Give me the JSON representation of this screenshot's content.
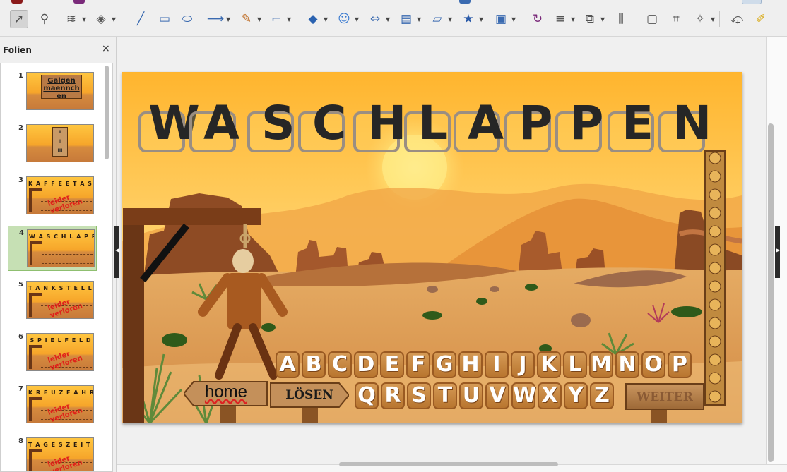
{
  "toolbar": {
    "tools": [
      {
        "icon": "select-cursor-icon"
      },
      {
        "icon": "zoom-pan-icon"
      },
      {
        "icon": "line-color-icon"
      },
      {
        "icon": "fill-color-icon"
      },
      {
        "icon": "line-icon"
      },
      {
        "icon": "rectangle-icon"
      },
      {
        "icon": "ellipse-icon"
      },
      {
        "icon": "line-ends-arrow-icon"
      },
      {
        "icon": "curves-polygons-icon"
      },
      {
        "icon": "connectors-icon"
      },
      {
        "icon": "basic-shapes-icon"
      },
      {
        "icon": "symbol-shapes-icon"
      },
      {
        "icon": "block-arrows-icon"
      },
      {
        "icon": "flowchart-icon"
      },
      {
        "icon": "callouts-icon"
      },
      {
        "icon": "stars-icon"
      },
      {
        "icon": "3d-objects-icon"
      },
      {
        "icon": "rotate-icon"
      },
      {
        "icon": "align-icon"
      },
      {
        "icon": "arrange-icon"
      },
      {
        "icon": "distribute-icon"
      },
      {
        "icon": "shadow-icon"
      },
      {
        "icon": "crop-icon"
      },
      {
        "icon": "filter-wand-icon"
      },
      {
        "icon": "points-icon"
      },
      {
        "icon": "glue-points-icon"
      }
    ]
  },
  "slide_panel": {
    "title": "Folien",
    "close_glyph": "×",
    "slides": [
      {
        "number": "1",
        "title": "Galgen maennch en",
        "note": "",
        "selected": false
      },
      {
        "number": "2",
        "title": "",
        "levels": [
          "I",
          "II",
          "III"
        ],
        "note": "",
        "selected": false
      },
      {
        "number": "3",
        "title": "KAFFEETASSE",
        "note": "leider verloren",
        "selected": false
      },
      {
        "number": "4",
        "title": "WASCHLAPPEN",
        "note": "",
        "selected": true
      },
      {
        "number": "5",
        "title": "TANKSTELLE",
        "note": "leider verloren",
        "selected": false
      },
      {
        "number": "6",
        "title": "SPIELFELD",
        "note": "leider verloren",
        "selected": false
      },
      {
        "number": "7",
        "title": "KREUZFAHRT",
        "note": "leider verloren",
        "selected": false
      },
      {
        "number": "8",
        "title": "TAGESZEITUNG",
        "note": "leider verloren",
        "selected": false
      }
    ]
  },
  "slide": {
    "word_letters": [
      "W",
      "A",
      "S",
      "C",
      "H",
      "L",
      "A",
      "P",
      "P",
      "E",
      "N"
    ],
    "keys_row1": [
      "A",
      "B",
      "C",
      "D",
      "E",
      "F",
      "G",
      "H",
      "I",
      "J",
      "K",
      "L",
      "M",
      "N",
      "O",
      "P"
    ],
    "keys_row2": [
      "Q",
      "R",
      "S",
      "T",
      "U",
      "V",
      "W",
      "X",
      "Y",
      "Z"
    ],
    "home_label": "home",
    "solve_label": "LÖSEN",
    "next_label": "WEITER",
    "colors": {
      "sky_top": "#ffc23a",
      "sun": "#fff3a0",
      "mesa": "#9b5a2c",
      "ground": "#d99a52",
      "key": "#c98a45"
    }
  }
}
